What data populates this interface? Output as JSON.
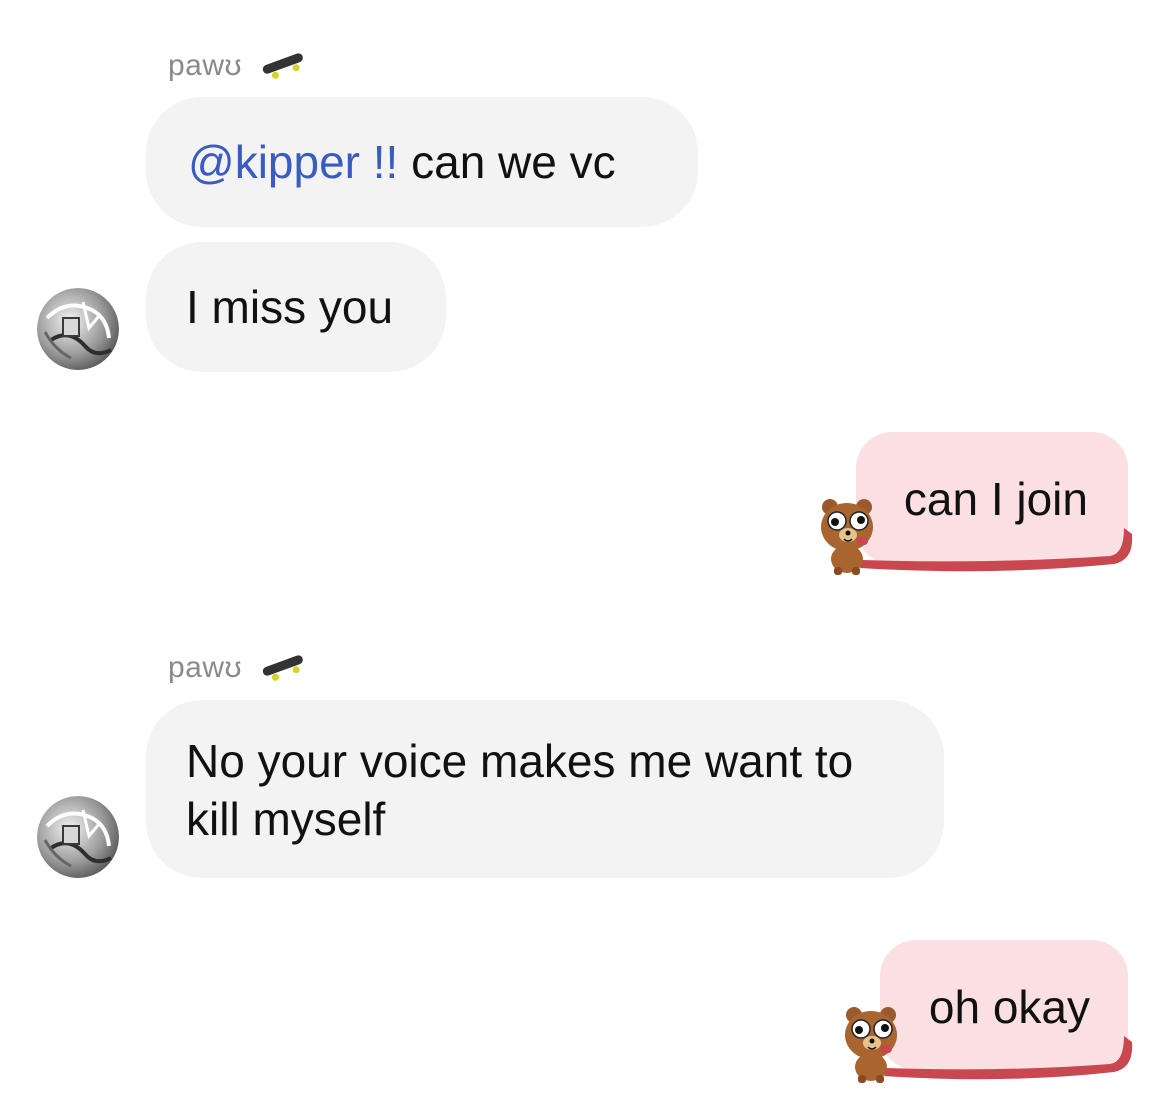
{
  "messages": [
    {
      "sender": "pawʊ",
      "text_mention": "@kipper !!",
      "text": " can we vc",
      "direction": "incoming"
    },
    {
      "text": "I miss you",
      "direction": "incoming"
    },
    {
      "text": "can I join",
      "direction": "outgoing"
    },
    {
      "sender": "pawʊ",
      "text": "No your voice makes me want to kill myself",
      "direction": "incoming"
    },
    {
      "text": "oh okay",
      "direction": "outgoing"
    }
  ],
  "icons": {
    "sender_badge": "skateboard-icon",
    "incoming_avatar": "avatar",
    "outgoing_sticker": "bear-sticker-icon"
  },
  "colors": {
    "incoming_bubble": "#f3f3f3",
    "outgoing_bubble": "#fbe0e3",
    "mention": "#3a5bbf",
    "outgoing_tail": "#c9474f",
    "sender_name": "#8a8a8a"
  }
}
